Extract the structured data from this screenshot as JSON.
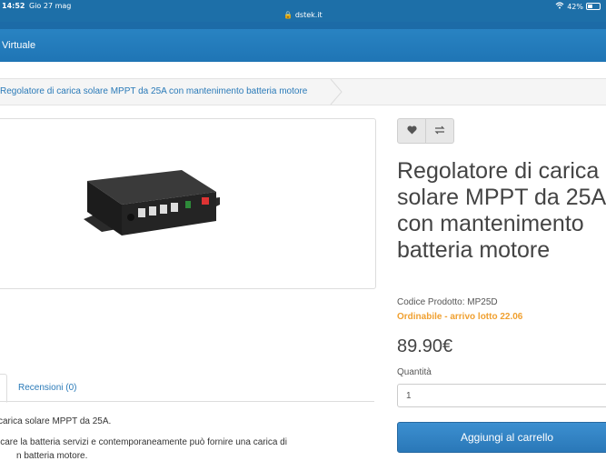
{
  "status_bar": {
    "time": "14:52",
    "date": "Gio 27 mag",
    "url": "dstek.it",
    "battery": "42%",
    "battery_level": 0.42
  },
  "navbar": {
    "item": "Virtuale"
  },
  "breadcrumb": {
    "current": "Regolatore di carica solare MPPT da 25A con mantenimento batteria motore"
  },
  "product": {
    "title": "Regolatore di carica solare MPPT da 25A con mantenimento batteria motore",
    "code": "Codice Prodotto: MP25D",
    "availability": "Ordinabile - arrivo lotto 22.06",
    "price": "89.90€",
    "quantity_label": "Quantità",
    "quantity_value": "1",
    "add_to_cart": "Aggiungi al carrello",
    "wishlist_icon": "heart-icon",
    "compare_icon": "compare-arrows-icon"
  },
  "tabs": {
    "reviews": "Recensioni (0)"
  },
  "description": {
    "line1": "carica solare MPPT da 25A.",
    "line2": "icare la batteria servizi e contemporaneamente può fornire una carica di",
    "line3": "n batteria motore."
  },
  "colors": {
    "nav": "#2b86c5",
    "accent": "#2a7ab8",
    "availability": "#f0a030",
    "button": "#3c8fd0"
  }
}
